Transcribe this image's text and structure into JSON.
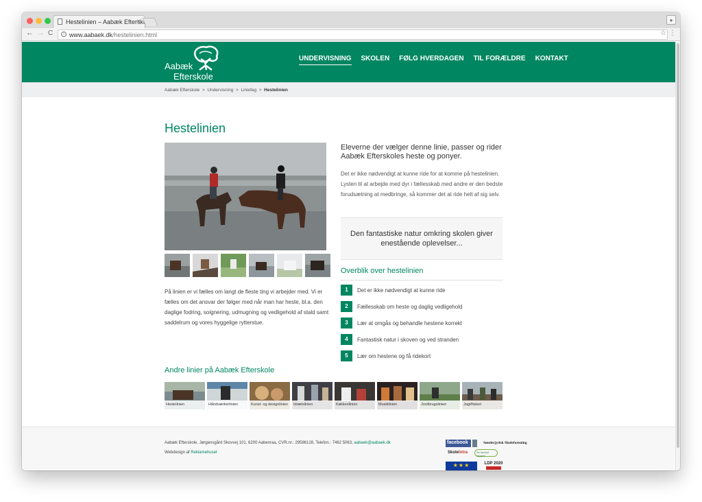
{
  "browser": {
    "tab_title": "Hestelinien – Aabæk Efterskol",
    "tab_close": "×",
    "url_domain": "www.aabaek.dk",
    "url_path": "/hestelinien.html",
    "back": "←",
    "forward": "→",
    "reload": "C",
    "info": "i",
    "star": "☆",
    "menu": "⋮"
  },
  "header": {
    "logo_line1": "Aabæk",
    "logo_line2": "Efterskole",
    "nav": [
      "UNDERVISNING",
      "SKOLEN",
      "FØLG HVERDAGEN",
      "TIL FORÆLDRE",
      "KONTAKT"
    ],
    "active_nav": "UNDERVISNING"
  },
  "breadcrumb": {
    "items": [
      "Aabæk Efterskole",
      "Undervisning",
      "Liniefag"
    ],
    "separator": ">",
    "current": "Hestelinien"
  },
  "main": {
    "title": "Hestelinien",
    "body_text": "På linien er vi fælles om langt de fleste ting vi arbejder med. Vi er fælles om det ansvar der følger med når man har heste, bl.a. den daglige fodring, soignering, udmugning og vedligehold af stald samt saddelrum og vores hyggelige rytterstue.",
    "intro": "Eleverne der vælger denne linie, passer og rider Aabæk Efterskoles heste og ponyer.",
    "text": "Det er ikke nødvendigt at kunne ride for at komme på hestelinien. Lysten til at arbejde med dyr i fællesskab med andre er den bedste forudsætning at medbringe, så kommer det at ride helt af sig selv.",
    "quote": "Den fantastiske natur omkring skolen giver enestående oplevelser...",
    "overview_title": "Overblik over hestelinien",
    "overview": [
      {
        "num": "1",
        "text": "Det er ikke nødvendigt at kunne ride"
      },
      {
        "num": "2",
        "text": "Fællesskab om heste og daglig vedligehold"
      },
      {
        "num": "3",
        "text": "Lær at omgås og behandle hestene korrekt"
      },
      {
        "num": "4",
        "text": "Fantastisk natur i skoven og ved stranden"
      },
      {
        "num": "5",
        "text": "Lær om hestene og få ridekort"
      }
    ],
    "other_lines_title": "Andre linier på Aabæk Efterskole",
    "other_lines": [
      "Hestelinien",
      "Håndværkerlinien",
      "Kunst- og designlinien",
      "Idrætslinien",
      "Køkkenlinien",
      "Musiklinien",
      "Jordbrugslinien",
      "Jagt/fiskeri"
    ]
  },
  "footer": {
    "address": "Aabæk Efterskole, Jørgensgård Skovvej 101, 6200 Aabenraa, CVR.nr.: 29586128, Telefon.: 7462 5063,",
    "email": "aabaek@aabaek.dk",
    "webdesign_prefix": "Webdesign af",
    "webdesign_link": "Reklamehuset",
    "logos": {
      "facebook": "facebook",
      "sonderjysk": "Sønderjydsk Skoleforening",
      "skoleintra_a": "Skole",
      "skoleintra_b": "Intra",
      "kontrol": "Se kontrol rapport",
      "eu": "★★★",
      "ldp": "LDP 2020"
    }
  },
  "colors": {
    "brand": "#008660",
    "crumb_bg": "#eeeff0"
  }
}
